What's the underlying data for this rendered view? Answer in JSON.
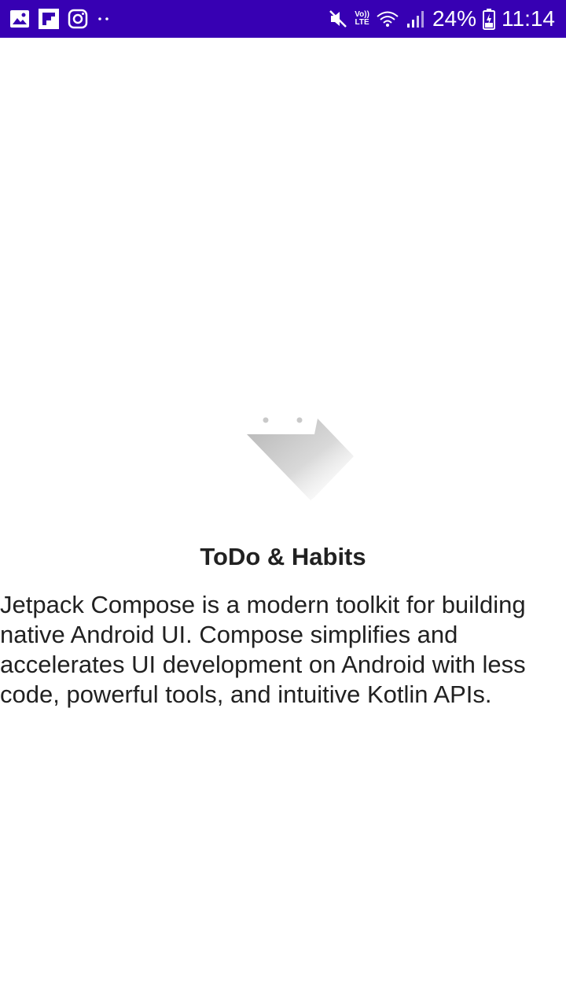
{
  "status_bar": {
    "left_icons": [
      "gallery-icon",
      "flipboard-icon",
      "instagram-icon",
      "more-notifications-icon"
    ],
    "right_icons": [
      "mute-icon",
      "volte-icon",
      "wifi-icon",
      "signal-icon",
      "battery-charging-icon"
    ],
    "volte_top": "Vo))",
    "volte_bottom": "LTE",
    "battery": "24%",
    "time": "11:14",
    "background_color": "#3700b3"
  },
  "splash": {
    "logo_icon": "calendar-check-icon",
    "title": "ToDo & Habits",
    "description": "Jetpack Compose is a modern toolkit for building native Android UI. Compose simplifies and accelerates UI development on Android with less code, powerful tools, and intuitive Kotlin APIs."
  }
}
